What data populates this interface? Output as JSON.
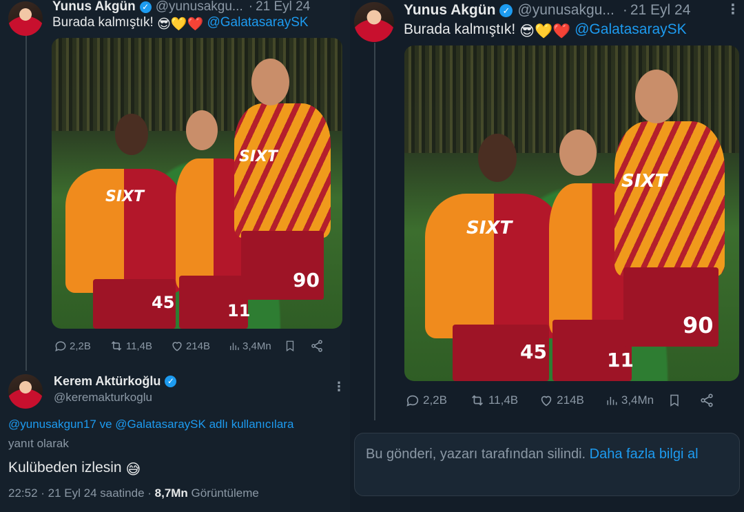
{
  "left": {
    "tweet": {
      "name": "Yunus Akgün",
      "handle": "@yunusakgu...",
      "date": "21 Eyl 24",
      "text": "Burada kalmıştık!",
      "emojis": "😎💛❤️",
      "mention": "@GalatasaraySK",
      "stats": {
        "replies": "2,2B",
        "retweets": "11,4B",
        "likes": "214B",
        "views": "3,4Mn"
      }
    },
    "reply": {
      "name": "Kerem Aktürkoğlu",
      "handle": "@keremakturkoglu",
      "reply_to_mentions": "@yunusakgun17 ve @GalatasaraySK adlı kullanıcılara",
      "reply_to_suffix": "yanıt olarak",
      "text": "Kulübeden izlesin",
      "emoji": "😅",
      "time": "22:52 · 21 Eyl 24 saatinde · ",
      "views_count": "8,7Mn",
      "views_label": " Görüntüleme"
    }
  },
  "right": {
    "tweet": {
      "name": "Yunus Akgün",
      "handle": "@yunusakgu...",
      "date": "21 Eyl 24",
      "text": "Burada kalmıştık!",
      "emojis": "😎💛❤️",
      "mention": "@GalatasaraySK",
      "stats": {
        "replies": "2,2B",
        "retweets": "11,4B",
        "likes": "214B",
        "views": "3,4Mn"
      }
    },
    "deleted_notice": {
      "text": "Bu gönderi, yazarı tarafından silindi.",
      "link": "Daha fazla bilgi al"
    }
  },
  "photo_labels": {
    "sponsor": "SIXT",
    "numbers": [
      "45",
      "11",
      "90"
    ]
  },
  "colors": {
    "background": "#15202b",
    "accent": "#1d9bf0",
    "muted": "#8b98a5",
    "text": "#e7e9ea"
  }
}
